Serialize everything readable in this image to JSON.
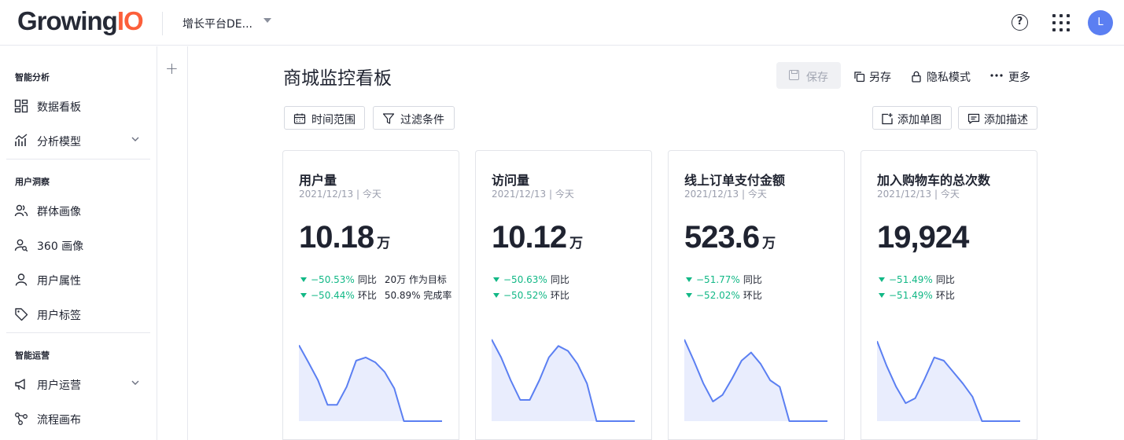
{
  "topbar": {
    "logo_main": "Growing",
    "logo_accent": "IO",
    "project_name": "增长平台DE...",
    "avatar_initial": "L",
    "help_symbol": "?"
  },
  "sidebar": {
    "sections": [
      {
        "title": "智能分析",
        "items": [
          {
            "label": "数据看板",
            "icon": "dashboard-icon"
          },
          {
            "label": "分析模型",
            "icon": "chart-icon",
            "expandable": true
          }
        ]
      },
      {
        "title": "用户洞察",
        "items": [
          {
            "label": "群体画像",
            "icon": "users-icon"
          },
          {
            "label": "360 画像",
            "icon": "user-search-icon"
          },
          {
            "label": "用户属性",
            "icon": "user-icon"
          },
          {
            "label": "用户标签",
            "icon": "tag-icon"
          }
        ]
      },
      {
        "title": "智能运营",
        "items": [
          {
            "label": "用户运营",
            "icon": "megaphone-icon",
            "expandable": true
          },
          {
            "label": "流程画布",
            "icon": "flow-icon"
          }
        ]
      }
    ]
  },
  "header": {
    "title": "商城监控看板",
    "save": "保存",
    "save_as": "另存",
    "privacy": "隐私模式",
    "more": "更多"
  },
  "filters": {
    "time_range": "时间范围",
    "conditions": "过滤条件",
    "add_chart": "添加单图",
    "add_desc": "添加描述"
  },
  "cards": [
    {
      "title": "用户量",
      "date": "2021/12/13 | 今天",
      "value": "10.18",
      "unit": "万",
      "yoy": "−50.53%",
      "yoy_label": "同比",
      "yoy_extra": "20万 作为目标",
      "mom": "−50.44%",
      "mom_label": "环比",
      "mom_extra": "50.89% 完成率",
      "spark": [
        0.93,
        0.72,
        0.5,
        0.2,
        0.2,
        0.42,
        0.74,
        0.78,
        0.72,
        0.6,
        0.4,
        0,
        0,
        0,
        0,
        0
      ]
    },
    {
      "title": "访问量",
      "date": "2021/12/13 | 今天",
      "value": "10.12",
      "unit": "万",
      "yoy": "−50.63%",
      "yoy_label": "同比",
      "yoy_extra": "",
      "mom": "−50.52%",
      "mom_label": "环比",
      "mom_extra": "",
      "spark": [
        1.0,
        0.78,
        0.5,
        0.26,
        0.26,
        0.5,
        0.78,
        0.92,
        0.86,
        0.7,
        0.46,
        0,
        0,
        0,
        0,
        0
      ]
    },
    {
      "title": "线上订单支付金额",
      "date": "2021/12/13 | 今天",
      "value": "523.6",
      "unit": "万",
      "yoy": "−51.77%",
      "yoy_label": "同比",
      "yoy_extra": "",
      "mom": "−52.02%",
      "mom_label": "环比",
      "mom_extra": "",
      "spark": [
        1.0,
        0.74,
        0.46,
        0.24,
        0.32,
        0.52,
        0.74,
        0.84,
        0.7,
        0.5,
        0.42,
        0,
        0,
        0,
        0,
        0
      ]
    },
    {
      "title": "加入购物车的总次数",
      "date": "2021/12/13 | 今天",
      "value": "19,924",
      "unit": "",
      "yoy": "−51.49%",
      "yoy_label": "同比",
      "yoy_extra": "",
      "mom": "−51.49%",
      "mom_label": "环比",
      "mom_extra": "",
      "spark": [
        0.98,
        0.68,
        0.42,
        0.22,
        0.28,
        0.52,
        0.78,
        0.74,
        0.6,
        0.46,
        0.3,
        0,
        0,
        0,
        0,
        0
      ]
    }
  ],
  "colors": {
    "accent": "#5b7ff2",
    "positive_down": "#12b886",
    "spark_line": "#5b7ff2",
    "spark_fill": "#e9edfd",
    "logo_accent": "#fc5f3a"
  }
}
